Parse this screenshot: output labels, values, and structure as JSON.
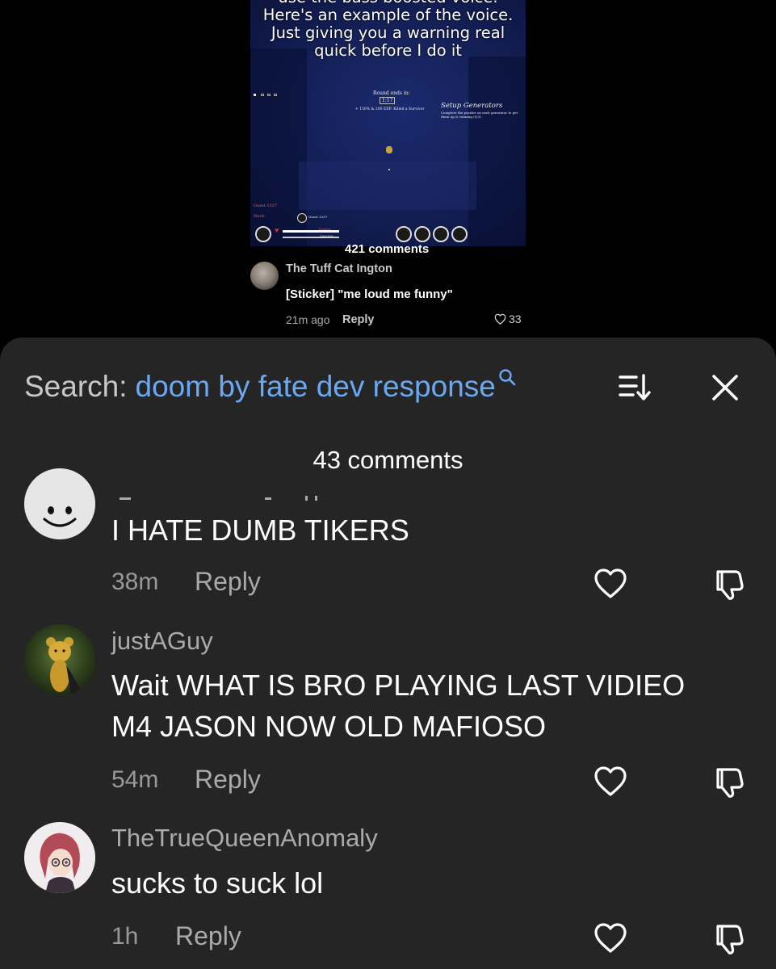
{
  "video": {
    "caption_lines": [
      "use the bass boosted voice.",
      "Here's an example of the voice.",
      "Just giving you a warning real",
      "quick before I do it"
    ],
    "game_hud": {
      "round_label": "Round ends in:",
      "timer": "1:17",
      "killfeed": "+ 150% & 200 EXP: Killed a Survivor",
      "objective_title": "Setup Generators",
      "objective_desc": "Complete the puzzles on each generator to get them up & running (0/3)",
      "player_name_1": "Guest 1337",
      "player_name_2": "Noob",
      "hp": "100/100",
      "stamina": "Stamina"
    },
    "comments_count": "421 comments",
    "overlay_comment": {
      "username": "The Tuff Cat Ington",
      "text": "[Sticker] \"me loud me funny\"",
      "time": "21m ago",
      "reply": "Reply",
      "likes": "33"
    }
  },
  "sheet": {
    "search_label": "Search:",
    "search_query": "doom by fate dev response",
    "icons": {
      "search": "search-icon",
      "sort": "sort-icon",
      "close": "close-icon"
    },
    "comments_count": "43 comments",
    "comments": [
      {
        "username": "",
        "text": "I HATE DUMB TIKERS",
        "time": "38m",
        "reply": "Reply"
      },
      {
        "username": "justAGuy",
        "text_lines": [
          "Wait WHAT IS BRO PLAYING LAST VIDIEO",
          "M4 JASON NOW OLD MAFIOSO"
        ],
        "time": "54m",
        "reply": "Reply"
      },
      {
        "username": "TheTrueQueenAnomaly",
        "text": "sucks to suck lol",
        "time": "1h",
        "reply": "Reply"
      }
    ]
  },
  "colors": {
    "sheet_bg": "#252525",
    "link_blue": "#6aa8f2",
    "muted_text": "#aaaaaa"
  }
}
